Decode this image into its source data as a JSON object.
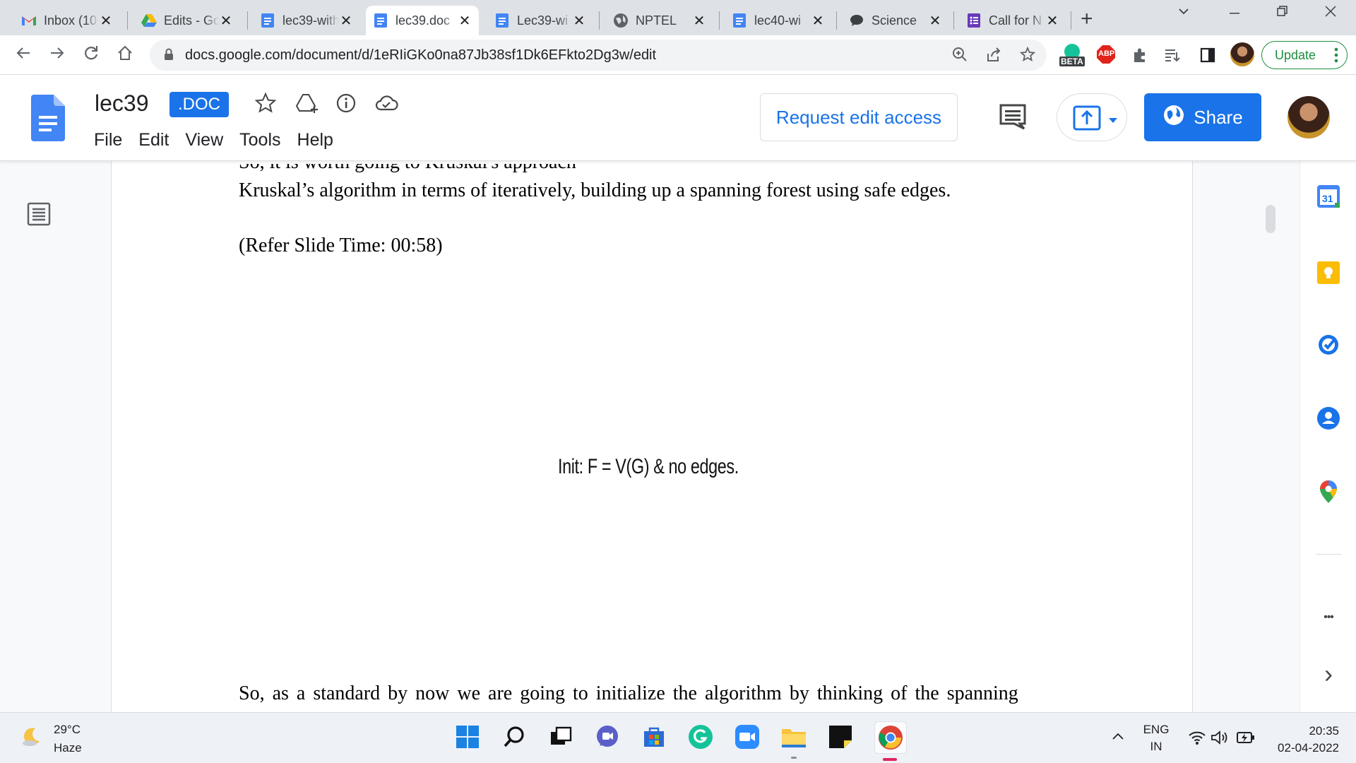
{
  "browser": {
    "tabs": [
      {
        "title": "Inbox (10",
        "favicon": "gmail-icon"
      },
      {
        "title": "Edits - Go",
        "favicon": "google-drive-icon"
      },
      {
        "title": "lec39-with",
        "favicon": "google-docs-icon"
      },
      {
        "title": "lec39.doc",
        "favicon": "google-docs-icon",
        "active": true
      },
      {
        "title": "Lec39-wi",
        "favicon": "google-docs-icon"
      },
      {
        "title": "NPTEL",
        "favicon": "globe-icon"
      },
      {
        "title": "lec40-wi",
        "favicon": "google-docs-icon"
      },
      {
        "title": "Science",
        "favicon": "chat-icon"
      },
      {
        "title": "Call for N",
        "favicon": "google-forms-icon"
      }
    ],
    "close_glyph": "✕",
    "new_tab_glyph": "+",
    "url": "docs.google.com/document/d/1eRIiGKo0na87Jb38sf1Dk6EFkto2Dg3w/edit",
    "beta_badge": "BETA",
    "abp_label": "ABP",
    "update_label": "Update"
  },
  "docs": {
    "title": "lec39",
    "badge": ".DOC",
    "menu": [
      "File",
      "Edit",
      "View",
      "Tools",
      "Help"
    ],
    "request_edit_label": "Request edit access",
    "share_label": "Share"
  },
  "document": {
    "cut_line": "So, it is worth going to Kruskal's approach",
    "paragraphs": [
      "Kruskal’s algorithm in terms of iteratively, building up a spanning forest using safe edges.",
      "(Refer Slide Time: 00:58)"
    ],
    "slide_caption": "Init: F = V(G) & no edges.",
    "last_paragraph": "So, as a standard by now we are going to initialize the algorithm by thinking of the spanning"
  },
  "side_panel": {
    "calendar_day": "31",
    "more_glyph": "•••",
    "expand_glyph": "›"
  },
  "taskbar": {
    "weather_temp": "29°C",
    "weather_cond": "Haze",
    "lang_top": "ENG",
    "lang_bottom": "IN",
    "time": "20:35",
    "date": "02-04-2022"
  },
  "colors": {
    "accent": "#1a73e8",
    "gmail_red": "#ea4335",
    "docs_blue": "#4285f4",
    "forms_purple": "#673ab7",
    "update_green": "#1e8e3e"
  }
}
